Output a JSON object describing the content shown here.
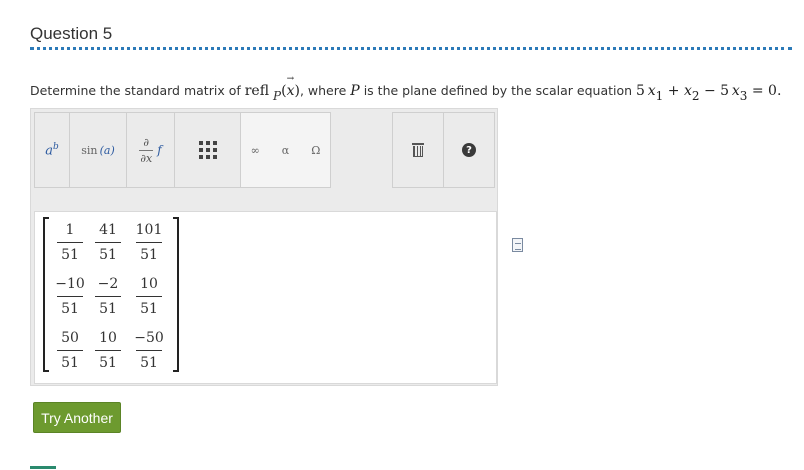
{
  "question": {
    "title": "Question 5",
    "prompt_text": "Determine the standard matrix of",
    "refl": "refl",
    "refl_sub": "P",
    "refl_arg": "(x)",
    "where_text": ", where",
    "plane_var": "P",
    "plane_text": "is the plane defined by the scalar equation",
    "equation": {
      "c1": "5",
      "v1": "x",
      "s1": "1",
      "op1": "+",
      "v2": "x",
      "s2": "2",
      "op2": "−",
      "c3": "5",
      "v3": "x",
      "s3": "3",
      "eq": "= 0."
    }
  },
  "toolbar": {
    "superscript_icon": "superscript-icon",
    "sin_label": "sin",
    "sin_arg": "(a)",
    "partial_top": "∂",
    "partial_bottom": "∂x",
    "partial_f": "f",
    "matrix_icon": "matrix-icon",
    "infinity": "∞",
    "alpha": "α",
    "omega": "Ω",
    "trash_icon": "trash-icon",
    "help_label": "?"
  },
  "matrix": [
    [
      {
        "n": "1",
        "d": "51"
      },
      {
        "n": "41",
        "d": "51"
      },
      {
        "n": "101",
        "d": "51"
      }
    ],
    [
      {
        "n": "−10",
        "d": "51"
      },
      {
        "n": "−2",
        "d": "51"
      },
      {
        "n": "10",
        "d": "51"
      }
    ],
    [
      {
        "n": "50",
        "d": "51"
      },
      {
        "n": "10",
        "d": "51"
      },
      {
        "n": "−50",
        "d": "51"
      }
    ]
  ],
  "try_button": "Try Another",
  "colors": {
    "accent": "#2c7ab8",
    "button": "#6d9a2f"
  }
}
